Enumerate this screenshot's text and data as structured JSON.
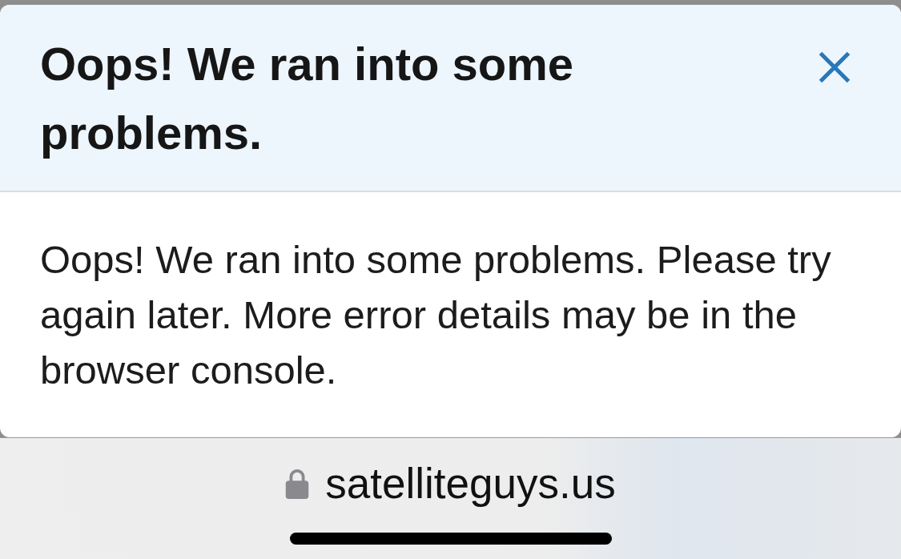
{
  "dialog": {
    "title": "Oops! We ran into some problems.",
    "message": "Oops! We ran into some problems. Please try again later. More error details may be in the browser console."
  },
  "browser_bar": {
    "secure": true,
    "url": "satelliteguys.us"
  }
}
